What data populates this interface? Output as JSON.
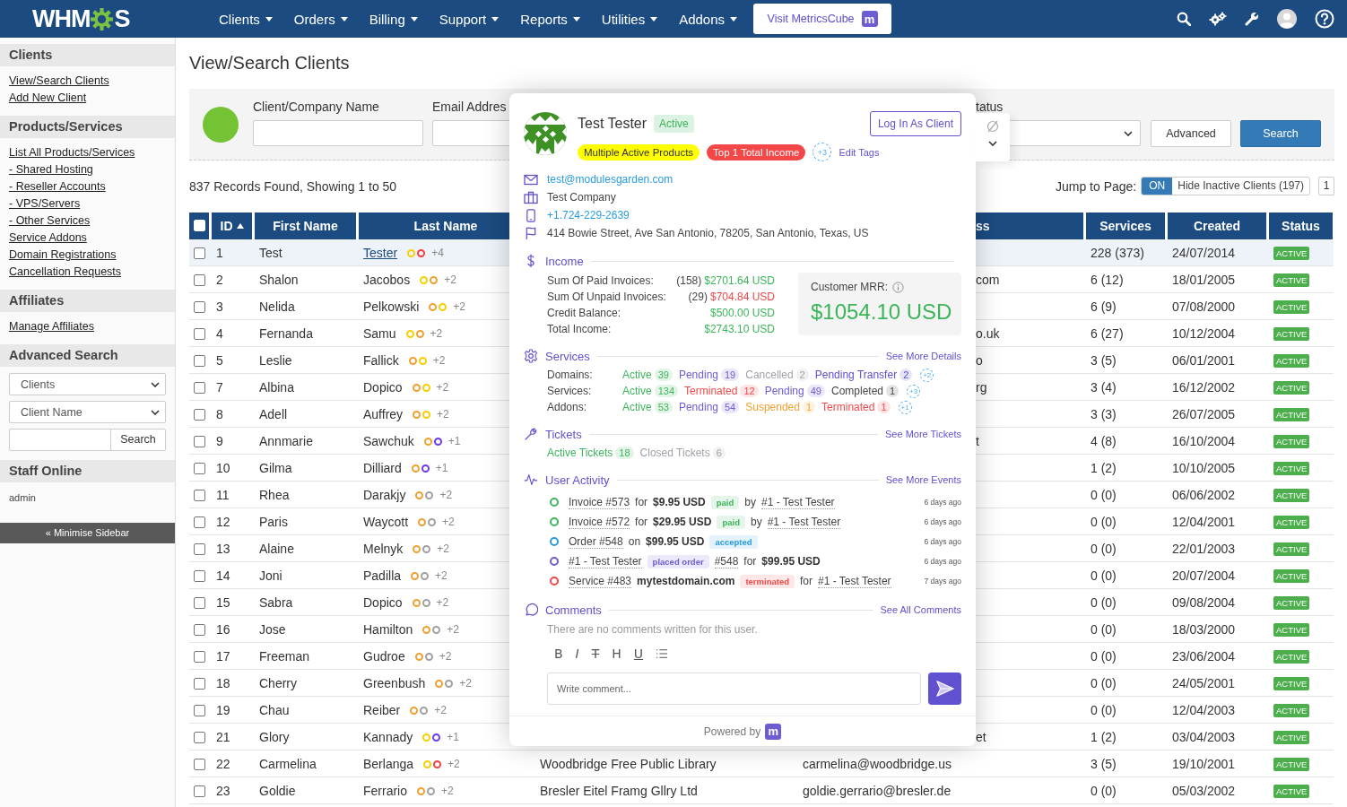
{
  "topbar": {
    "logo": {
      "before": "WHM",
      "after": "S"
    },
    "menu": [
      {
        "label": "Clients"
      },
      {
        "label": "Orders"
      },
      {
        "label": "Billing"
      },
      {
        "label": "Support"
      },
      {
        "label": "Reports"
      },
      {
        "label": "Utilities"
      },
      {
        "label": "Addons"
      }
    ],
    "promo": {
      "label": "Visit MetricsCube",
      "badge": "m"
    }
  },
  "sidebar": {
    "sections": [
      {
        "kind": "links",
        "title": "Clients",
        "links": [
          "View/Search Clients",
          "Add New Client"
        ]
      },
      {
        "kind": "links",
        "title": "Products/Services",
        "links": [
          "List All Products/Services",
          "- Shared Hosting",
          "- Reseller Accounts",
          "- VPS/Servers",
          "- Other Services",
          "Service Addons",
          "Domain Registrations",
          "Cancellation Requests"
        ]
      },
      {
        "kind": "links",
        "title": "Affiliates",
        "links": [
          "Manage Affiliates"
        ]
      },
      {
        "kind": "search",
        "title": "Advanced Search",
        "selects": [
          "Clients",
          "Client Name"
        ],
        "button": "Search"
      },
      {
        "kind": "staff",
        "title": "Staff Online",
        "names": [
          "admin"
        ]
      }
    ],
    "minimise": "« Minimise Sidebar"
  },
  "page": {
    "title": "View/Search Clients"
  },
  "filters": {
    "fields": [
      {
        "label": "Client/Company Name",
        "kind": "input"
      },
      {
        "label": "Email Addres",
        "kind": "input"
      },
      {
        "label": "tatus",
        "kind": "select"
      }
    ],
    "buttons": [
      {
        "label": "Advanced",
        "kind": "plain"
      },
      {
        "label": "Search",
        "kind": "primary"
      }
    ]
  },
  "summary": "837 Records Found, Showing 1 to 50",
  "jump": {
    "label": "Jump to Page:",
    "toggle": {
      "state_label": "ON",
      "label": "Hide Inactive Clients (197)",
      "on": true
    },
    "page": "1"
  },
  "table": {
    "all_checked": false,
    "columns": [
      {
        "label": "ID",
        "kind": "id",
        "sorted": true
      },
      {
        "label": "First Name",
        "kind": "plain",
        "sorted": false
      },
      {
        "label": "Last Name",
        "kind": "plain",
        "sorted": false
      },
      {
        "label": "ss",
        "kind": "tail",
        "sorted": false
      },
      {
        "label": "Services",
        "kind": "plain",
        "sorted": false
      },
      {
        "label": "Created",
        "kind": "plain",
        "sorted": false
      },
      {
        "label": "Status",
        "kind": "plain",
        "sorted": false
      }
    ],
    "rows": [
      {
        "id": "1",
        "first": "Test",
        "last": "Tester",
        "dots": [
          {
            "color": "#f5d000"
          },
          {
            "color": "#f04040"
          }
        ],
        "more": "+4",
        "services": "228 (373)",
        "created": "24/07/2014",
        "status": "ACTIVE",
        "selected": true,
        "checked": false
      },
      {
        "id": "2",
        "first": "Shalon",
        "last": "Jacobos",
        "dots": [
          {
            "color": "#f5d000"
          },
          {
            "color": "#f0a030"
          }
        ],
        "more": "+2",
        "email": "com",
        "services": "6 (12)",
        "created": "18/01/2005",
        "status": "ACTIVE",
        "selected": false,
        "checked": false
      },
      {
        "id": "3",
        "first": "Nelida",
        "last": "Pelkowski",
        "dots": [
          {
            "color": "#f0a030"
          },
          {
            "color": "#f5d000"
          }
        ],
        "more": "+2",
        "services": "6 (9)",
        "created": "07/08/2000",
        "status": "ACTIVE",
        "selected": false,
        "checked": false
      },
      {
        "id": "4",
        "first": "Fernanda",
        "last": "Samu",
        "dots": [
          {
            "color": "#f5d000"
          },
          {
            "color": "#f0a030"
          }
        ],
        "more": "+2",
        "email": "o.uk",
        "services": "6 (27)",
        "created": "10/12/2004",
        "status": "ACTIVE",
        "selected": false,
        "checked": false
      },
      {
        "id": "5",
        "first": "Leslie",
        "last": "Fallick",
        "dots": [
          {
            "color": "#f0a030"
          },
          {
            "color": "#f5d000"
          }
        ],
        "more": "+2",
        "email": "o",
        "services": "3 (5)",
        "created": "06/01/2001",
        "status": "ACTIVE",
        "selected": false,
        "checked": false
      },
      {
        "id": "7",
        "first": "Albina",
        "last": "Dopico",
        "dots": [
          {
            "color": "#f0a030"
          },
          {
            "color": "#f5d000"
          }
        ],
        "more": "+2",
        "email": "rg",
        "services": "3 (4)",
        "created": "16/12/2002",
        "status": "ACTIVE",
        "selected": false,
        "checked": false
      },
      {
        "id": "8",
        "first": "Adell",
        "last": "Auffrey",
        "dots": [
          {
            "color": "#f0a030"
          },
          {
            "color": "#f5d000"
          }
        ],
        "more": "+2",
        "services": "3 (3)",
        "created": "26/07/2005",
        "status": "ACTIVE",
        "selected": false,
        "checked": false
      },
      {
        "id": "9",
        "first": "Annmarie",
        "last": "Sawchuk",
        "dots": [
          {
            "color": "#f0a030"
          },
          {
            "color": "#6a3cf0"
          }
        ],
        "more": "+1",
        "email": "t",
        "services": "4 (8)",
        "created": "16/10/2004",
        "status": "ACTIVE",
        "selected": false,
        "checked": false
      },
      {
        "id": "10",
        "first": "Gilma",
        "last": "Dilliard",
        "dots": [
          {
            "color": "#f0a030"
          },
          {
            "color": "#6a3cf0"
          }
        ],
        "more": "+1",
        "services": "1 (2)",
        "created": "10/10/2005",
        "status": "ACTIVE",
        "selected": false,
        "checked": false
      },
      {
        "id": "11",
        "first": "Rhea",
        "last": "Darakjy",
        "dots": [
          {
            "color": "#f0a030"
          },
          {
            "color": "#a0a0a0"
          }
        ],
        "more": "+2",
        "services": "0 (0)",
        "created": "06/06/2002",
        "status": "ACTIVE",
        "selected": false,
        "checked": false
      },
      {
        "id": "12",
        "first": "Paris",
        "last": "Waycott",
        "dots": [
          {
            "color": "#f0a030"
          },
          {
            "color": "#a0a0a0"
          }
        ],
        "more": "+2",
        "services": "0 (0)",
        "created": "12/04/2001",
        "status": "ACTIVE",
        "selected": false,
        "checked": false
      },
      {
        "id": "13",
        "first": "Alaine",
        "last": "Melnyk",
        "dots": [
          {
            "color": "#f0a030"
          },
          {
            "color": "#a0a0a0"
          }
        ],
        "more": "+2",
        "services": "0 (0)",
        "created": "22/01/2003",
        "status": "ACTIVE",
        "selected": false,
        "checked": false
      },
      {
        "id": "14",
        "first": "Joni",
        "last": "Padilla",
        "dots": [
          {
            "color": "#f0a030"
          },
          {
            "color": "#a0a0a0"
          }
        ],
        "more": "+2",
        "services": "0 (0)",
        "created": "20/07/2004",
        "status": "ACTIVE",
        "selected": false,
        "checked": false
      },
      {
        "id": "15",
        "first": "Sabra",
        "last": "Dopico",
        "dots": [
          {
            "color": "#f0a030"
          },
          {
            "color": "#a0a0a0"
          }
        ],
        "more": "+2",
        "services": "0 (0)",
        "created": "09/08/2004",
        "status": "ACTIVE",
        "selected": false,
        "checked": false
      },
      {
        "id": "16",
        "first": "Jose",
        "last": "Hamilton",
        "dots": [
          {
            "color": "#f0a030"
          },
          {
            "color": "#a0a0a0"
          }
        ],
        "more": "+2",
        "services": "0 (0)",
        "created": "18/03/2000",
        "status": "ACTIVE",
        "selected": false,
        "checked": false
      },
      {
        "id": "17",
        "first": "Freeman",
        "last": "Gudroe",
        "dots": [
          {
            "color": "#f0a030"
          },
          {
            "color": "#a0a0a0"
          }
        ],
        "more": "+2",
        "services": "0 (0)",
        "created": "23/06/2004",
        "status": "ACTIVE",
        "selected": false,
        "checked": false
      },
      {
        "id": "18",
        "first": "Cherry",
        "last": "Greenbush",
        "dots": [
          {
            "color": "#f0a030"
          },
          {
            "color": "#a0a0a0"
          }
        ],
        "more": "+2",
        "services": "0 (0)",
        "created": "24/05/2001",
        "status": "ACTIVE",
        "selected": false,
        "checked": false
      },
      {
        "id": "19",
        "first": "Chau",
        "last": "Reiber",
        "dots": [
          {
            "color": "#f0a030"
          },
          {
            "color": "#a0a0a0"
          }
        ],
        "more": "+2",
        "services": "0 (0)",
        "created": "12/04/2003",
        "status": "ACTIVE",
        "selected": false,
        "checked": false
      },
      {
        "id": "21",
        "first": "Glory",
        "last": "Kannady",
        "dots": [
          {
            "color": "#f5d000"
          },
          {
            "color": "#6a3cf0"
          }
        ],
        "more": "+1",
        "email": "et",
        "services": "1 (2)",
        "created": "03/04/2003",
        "status": "ACTIVE",
        "selected": false,
        "checked": false
      },
      {
        "id": "22",
        "first": "Carmelina",
        "last": "Berlanga",
        "dots": [
          {
            "color": "#f5d000"
          },
          {
            "color": "#f04040"
          }
        ],
        "more": "+2",
        "company": "Woodbridge Free Public Library",
        "email": "carmelina@woodbridge.us",
        "services": "3 (5)",
        "created": "19/10/2001",
        "status": "ACTIVE",
        "selected": false,
        "checked": false
      },
      {
        "id": "23",
        "first": "Goldie",
        "last": "Ferrario",
        "dots": [
          {
            "color": "#f0a030"
          },
          {
            "color": "#a0a0a0"
          }
        ],
        "more": "+2",
        "company": "Bresler Eitel Framg Gllry Ltd",
        "email": "goldie.gerrario@bresler.de",
        "services": "0 (0)",
        "created": "05/03/2002",
        "status": "ACTIVE",
        "selected": false,
        "checked": false
      }
    ]
  },
  "popup": {
    "name": "Test Tester",
    "status": "Active",
    "login": "Log In As Client",
    "tags": [
      {
        "label": "Multiple Active Products",
        "color": "#ffff00"
      },
      {
        "label": "Top 1 Total Income",
        "color": "#f44848"
      }
    ],
    "more_tags": "+3",
    "edit_tags": "Edit Tags",
    "contacts": [
      {
        "kind": "email",
        "text": "test@modulesgarden.com"
      },
      {
        "kind": "company",
        "text": "Test Company"
      },
      {
        "kind": "phone",
        "text": "+1.724-229-2639"
      },
      {
        "kind": "address",
        "text": "414 Bowie Street, Ave San Antonio, 78205, San Antonio, Texas, US"
      }
    ],
    "income": {
      "title": "Income",
      "rows": [
        {
          "label": "Sum Of Paid Invoices:",
          "count": "(158)",
          "amount": "$2701.64 USD",
          "color": "#3cb55a"
        },
        {
          "label": "Sum Of Unpaid Invoices:",
          "count": "(29)",
          "amount": "$704.84 USD",
          "color": "#f04848"
        },
        {
          "label": "Credit Balance:",
          "amount": "$500.00 USD",
          "color": "#3cb55a"
        },
        {
          "label": "Total Income:",
          "amount": "$2743.10 USD",
          "color": "#3cb55a"
        }
      ],
      "mrr": {
        "label": "Customer MRR:",
        "value": "$1054.10 USD"
      }
    },
    "services": {
      "title": "Services",
      "link": "See More Details",
      "rows": [
        {
          "label": "Domains:",
          "items": [
            {
              "label": "Active",
              "count": "39",
              "color": "#3cb55a"
            },
            {
              "label": "Pending",
              "count": "19",
              "color": "#6c5dd3"
            },
            {
              "label": "Cancelled",
              "count": "2",
              "color": "#a0a0a8"
            },
            {
              "label": "Pending Transfer",
              "count": "2",
              "color": "#5a4fcf"
            }
          ],
          "more": "+2"
        },
        {
          "label": "Services:",
          "items": [
            {
              "label": "Active",
              "count": "134",
              "color": "#3cb55a"
            },
            {
              "label": "Terminated",
              "count": "12",
              "color": "#f04848"
            },
            {
              "label": "Pending",
              "count": "49",
              "color": "#6c5dd3"
            },
            {
              "label": "Completed",
              "count": "1",
              "color": "#444444"
            }
          ],
          "more": "+3"
        },
        {
          "label": "Addons:",
          "items": [
            {
              "label": "Active",
              "count": "53",
              "color": "#3cb55a"
            },
            {
              "label": "Pending",
              "count": "54",
              "color": "#6c5dd3"
            },
            {
              "label": "Suspended",
              "count": "1",
              "color": "#f5a030"
            },
            {
              "label": "Terminated",
              "count": "1",
              "color": "#f04848"
            }
          ],
          "more": "+1"
        }
      ]
    },
    "tickets": {
      "title": "Tickets",
      "link": "See More Tickets",
      "items": [
        {
          "label": "Active Tickets",
          "count": "18",
          "color": "#3cb55a"
        },
        {
          "label": "Closed Tickets",
          "count": "6",
          "color": "#a0a0a8"
        }
      ]
    },
    "activity": {
      "title": "User Activity",
      "link": "See More Events",
      "events": [
        {
          "color": "#3cb55a",
          "time": "6 days ago",
          "parts": [
            {
              "kind": "link",
              "text": "Invoice #573"
            },
            {
              "kind": "text",
              "text": "for"
            },
            {
              "kind": "bold",
              "text": "$9.95 USD"
            },
            {
              "kind": "badge",
              "text": "paid",
              "color": "#3cb55a"
            },
            {
              "kind": "text",
              "text": "by"
            },
            {
              "kind": "link",
              "text": "#1 - Test Tester"
            }
          ]
        },
        {
          "color": "#3cb55a",
          "time": "6 days ago",
          "parts": [
            {
              "kind": "link",
              "text": "Invoice #572"
            },
            {
              "kind": "text",
              "text": "for"
            },
            {
              "kind": "bold",
              "text": "$29.95 USD"
            },
            {
              "kind": "badge",
              "text": "paid",
              "color": "#3cb55a"
            },
            {
              "kind": "text",
              "text": "by"
            },
            {
              "kind": "link",
              "text": "#1 - Test Tester"
            }
          ]
        },
        {
          "color": "#2a9be0",
          "time": "6 days ago",
          "parts": [
            {
              "kind": "link",
              "text": "Order #548"
            },
            {
              "kind": "text",
              "text": "on"
            },
            {
              "kind": "bold",
              "text": "$99.95 USD"
            },
            {
              "kind": "badge",
              "text": "accepted",
              "color": "#2a9be0"
            }
          ]
        },
        {
          "color": "#6c5dd3",
          "time": "6 days ago",
          "parts": [
            {
              "kind": "link",
              "text": "#1 - Test Tester"
            },
            {
              "kind": "badge",
              "text": "placed order",
              "color": "#6c5dd3"
            },
            {
              "kind": "link",
              "text": "#548"
            },
            {
              "kind": "text",
              "text": "for"
            },
            {
              "kind": "bold",
              "text": "$99.95 USD"
            }
          ]
        },
        {
          "color": "#f04848",
          "time": "7 days ago",
          "parts": [
            {
              "kind": "link",
              "text": "Service #483"
            },
            {
              "kind": "bold",
              "text": "mytestdomain.com"
            },
            {
              "kind": "badge",
              "text": "terminated",
              "color": "#f04848"
            },
            {
              "kind": "text",
              "text": "for"
            },
            {
              "kind": "link",
              "text": "#1 - Test Tester"
            }
          ]
        }
      ]
    },
    "comments": {
      "title": "Comments",
      "link": "See All Comments",
      "empty": "There are no comments written for this user.",
      "toolbar": [
        {
          "kind": "bold",
          "label": "B"
        },
        {
          "kind": "italic",
          "label": "I"
        },
        {
          "kind": "strike",
          "label": "T"
        },
        {
          "kind": "heading",
          "label": "H"
        },
        {
          "kind": "underline",
          "label": "U"
        },
        {
          "kind": "list"
        }
      ],
      "placeholder": "Write comment..."
    },
    "footer": {
      "label": "Powered by",
      "badge": "m"
    }
  }
}
